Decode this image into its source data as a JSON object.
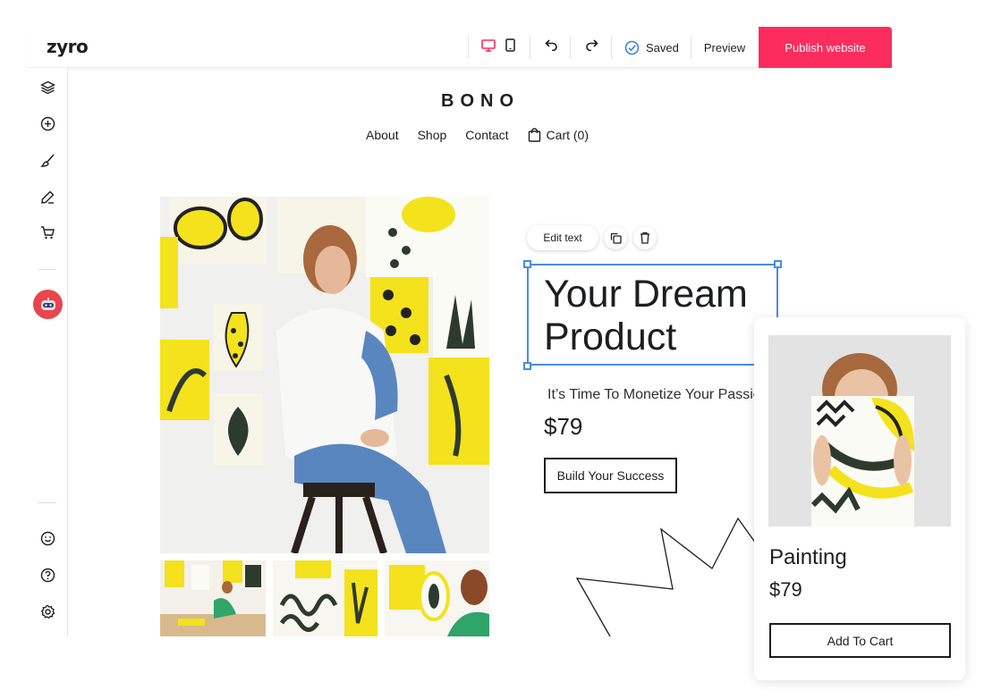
{
  "app": {
    "logo": "zyro",
    "saved_label": "Saved",
    "preview_label": "Preview",
    "publish_label": "Publish website",
    "publish_color": "#fc2d5e",
    "selection_color": "#4b8be0"
  },
  "toolbar": {
    "icons": [
      "desktop-icon",
      "mobile-icon",
      "undo-icon",
      "redo-icon",
      "check-circle-icon"
    ]
  },
  "sidebar": {
    "items": [
      "layers-icon",
      "add-element-icon",
      "brush-icon",
      "pen-icon",
      "cart-icon",
      "ai-robot-icon",
      "smiley-icon",
      "help-icon",
      "settings-icon"
    ]
  },
  "site": {
    "brand": "BONO",
    "nav": [
      "About",
      "Shop",
      "Contact"
    ],
    "cart_label": "Cart (0)",
    "editor": {
      "edit_text_label": "Edit text"
    },
    "hero": {
      "headline": "Your Dream Product",
      "tagline": "It’s Time To Monetize Your Passion",
      "price": "$79",
      "cta": "Build Your Success"
    },
    "product_card": {
      "title": "Painting",
      "price": "$79",
      "button": "Add To Cart"
    }
  }
}
